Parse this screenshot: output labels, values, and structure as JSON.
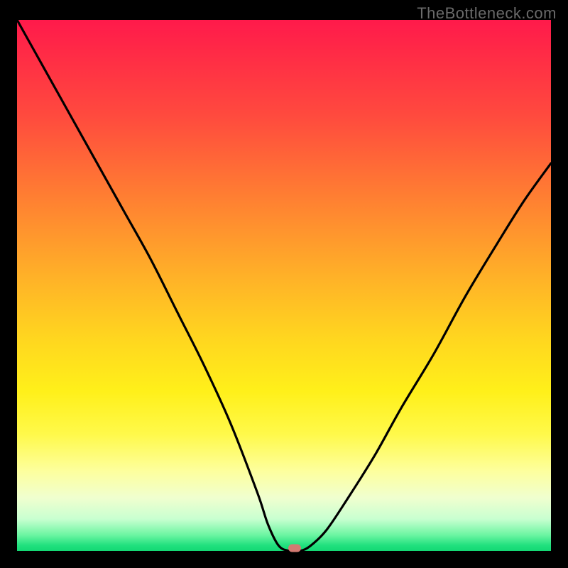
{
  "watermark": "TheBottleneck.com",
  "chart_data": {
    "type": "line",
    "title": "",
    "xlabel": "",
    "ylabel": "",
    "xlim": [
      0,
      100
    ],
    "ylim": [
      0,
      100
    ],
    "grid": false,
    "legend": false,
    "series": [
      {
        "name": "bottleneck-curve",
        "x": [
          0,
          5,
          10,
          15,
          20,
          25,
          30,
          35,
          40,
          45,
          47,
          49,
          51,
          53,
          55,
          58,
          62,
          67,
          72,
          78,
          84,
          90,
          95,
          100
        ],
        "y": [
          100,
          91,
          82,
          73,
          64,
          55,
          45,
          35,
          24,
          11,
          5,
          1,
          0,
          0,
          1,
          4,
          10,
          18,
          27,
          37,
          48,
          58,
          66,
          73
        ]
      }
    ],
    "marker": {
      "x": 52,
      "y": 0.5
    },
    "gradient_stops": [
      {
        "pos": 0.0,
        "color": "#ff1a4b"
      },
      {
        "pos": 0.5,
        "color": "#ffd61f"
      },
      {
        "pos": 0.8,
        "color": "#fff94a"
      },
      {
        "pos": 1.0,
        "color": "#14d874"
      }
    ]
  }
}
